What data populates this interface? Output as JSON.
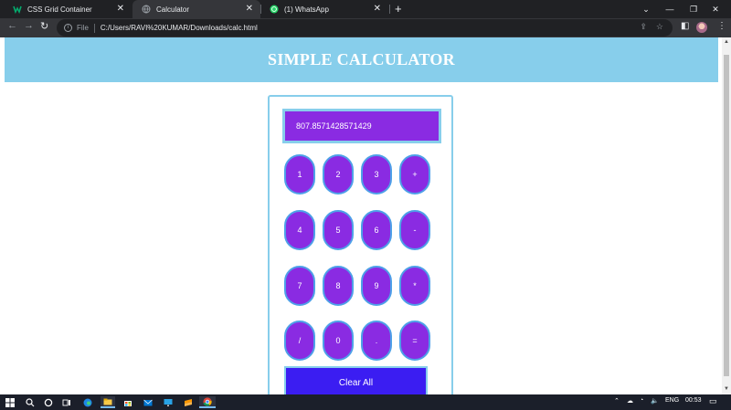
{
  "browser": {
    "tabs": [
      {
        "title": "CSS Grid Container",
        "icon": "w3schools-icon",
        "icon_color": "#04aa6d"
      },
      {
        "title": "Calculator",
        "icon": "globe-icon",
        "icon_color": "#9aa0a6"
      },
      {
        "title": "(1) WhatsApp",
        "icon": "whatsapp-icon",
        "icon_color": "#25d366"
      }
    ],
    "address": {
      "scheme_label": "File",
      "url": "C:/Users/RAVI%20KUMAR/Downloads/calc.html"
    }
  },
  "page": {
    "title": "SIMPLE CALCULATOR",
    "display_value": "807.8571428571429",
    "keys": [
      [
        "1",
        "2",
        "3",
        "+"
      ],
      [
        "4",
        "5",
        "6",
        "-"
      ],
      [
        "7",
        "8",
        "9",
        "*"
      ],
      [
        "/",
        "0",
        ".",
        "="
      ]
    ],
    "clear_label": "Clear All"
  },
  "taskbar": {
    "language": "ENG",
    "time": "00:53"
  },
  "colors": {
    "header": "#87ceeb",
    "button": "#8a2be2",
    "clear_button": "#3b1df2"
  }
}
